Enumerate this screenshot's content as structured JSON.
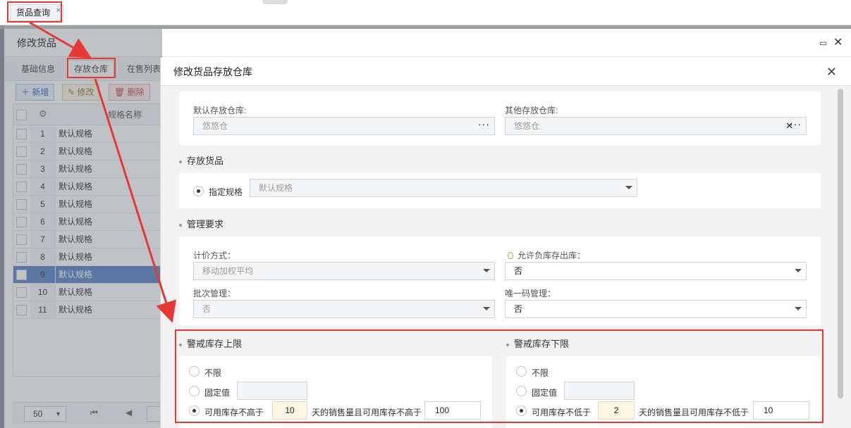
{
  "top_tab": {
    "label": "货品查询",
    "close": "×"
  },
  "outer": {
    "title": "修改货品",
    "tabs": [
      "基础信息",
      "存放仓库",
      "在售列表"
    ],
    "toolbar": {
      "add": "＋ 新增",
      "edit": "修改",
      "delete": "删除"
    },
    "grid": {
      "header": "规格名称",
      "rows": [
        {
          "n": "1",
          "name": "默认规格"
        },
        {
          "n": "2",
          "name": "默认规格"
        },
        {
          "n": "3",
          "name": "默认规格"
        },
        {
          "n": "4",
          "name": "默认规格"
        },
        {
          "n": "5",
          "name": "默认规格"
        },
        {
          "n": "6",
          "name": "默认规格"
        },
        {
          "n": "7",
          "name": "默认规格"
        },
        {
          "n": "8",
          "name": "默认规格"
        },
        {
          "n": "9",
          "name": "默认规格"
        },
        {
          "n": "10",
          "name": "默认规格"
        },
        {
          "n": "11",
          "name": "默认规格"
        }
      ],
      "selected_row": 9
    },
    "pager": {
      "page_size": "50"
    }
  },
  "inner": {
    "title": "修改货品存放仓库",
    "default_wh_label": "默认存放仓库:",
    "default_wh_value": "悠悠仓",
    "other_wh_label": "其他存放仓库:",
    "other_wh_value": "悠悠仓",
    "section_goods": "存放货品",
    "spec_radio_label": "指定规格",
    "spec_value": "默认规格",
    "section_mgmt": "管理要求",
    "pricing_label": "计价方式：",
    "pricing_value": "移动加权平均",
    "negative_label": "允许负库存出库：",
    "negative_value": "否",
    "batch_label": "批次管理：",
    "batch_value": "否",
    "unique_label": "唯一码管理：",
    "unique_value": "否",
    "upper": {
      "title": "警戒库存上限",
      "opt_unlimited": "不限",
      "opt_fixed": "固定值",
      "opt_rule_prefix": "可用库存不高于",
      "days": "10",
      "opt_rule_middle": "天的销售量且可用库存不高于",
      "limit": "100"
    },
    "lower": {
      "title": "警戒库存下限",
      "opt_unlimited": "不限",
      "opt_fixed": "固定值",
      "opt_rule_prefix": "可用库存不低于",
      "days": "2",
      "opt_rule_middle": "天的销售量且可用库存不低于",
      "limit": "10"
    }
  },
  "colors": {
    "annotation": "#e53935",
    "selected_row": "#5c86c9"
  }
}
